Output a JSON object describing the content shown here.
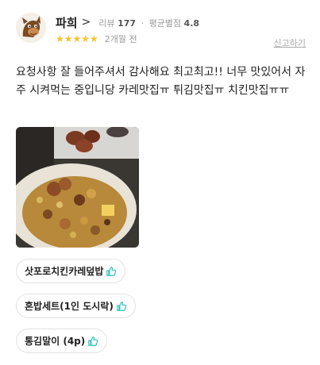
{
  "review": {
    "username": "파희",
    "chevron": ">",
    "reviews_label": "리뷰",
    "reviews_count": "177",
    "avg_label": "평균별점",
    "avg_rating": "4.8",
    "stars": "★★★★★",
    "rating_value": 5,
    "date": "2개월 전",
    "report_label": "신고하기",
    "text": "요청사항 잘 들어주셔서 감사해요 최고최고!! 너무 맛있어서 자주 시켜먹는 중입니당 카레맛집ㅠ 튀김맛집ㅠ 치킨맛집ㅠㅠ"
  },
  "menu_tags": [
    {
      "label": "삿포로치킨카레덮밥",
      "icon": "thumbs-up-icon"
    },
    {
      "label": "혼밥세트(1인 도시락)",
      "icon": "thumbs-up-icon"
    },
    {
      "label": "통김말이 (4p)",
      "icon": "thumbs-up-icon"
    }
  ],
  "colors": {
    "star": "#fbc02d",
    "thumb": "#2ac1bc",
    "meta_text": "#999999"
  }
}
